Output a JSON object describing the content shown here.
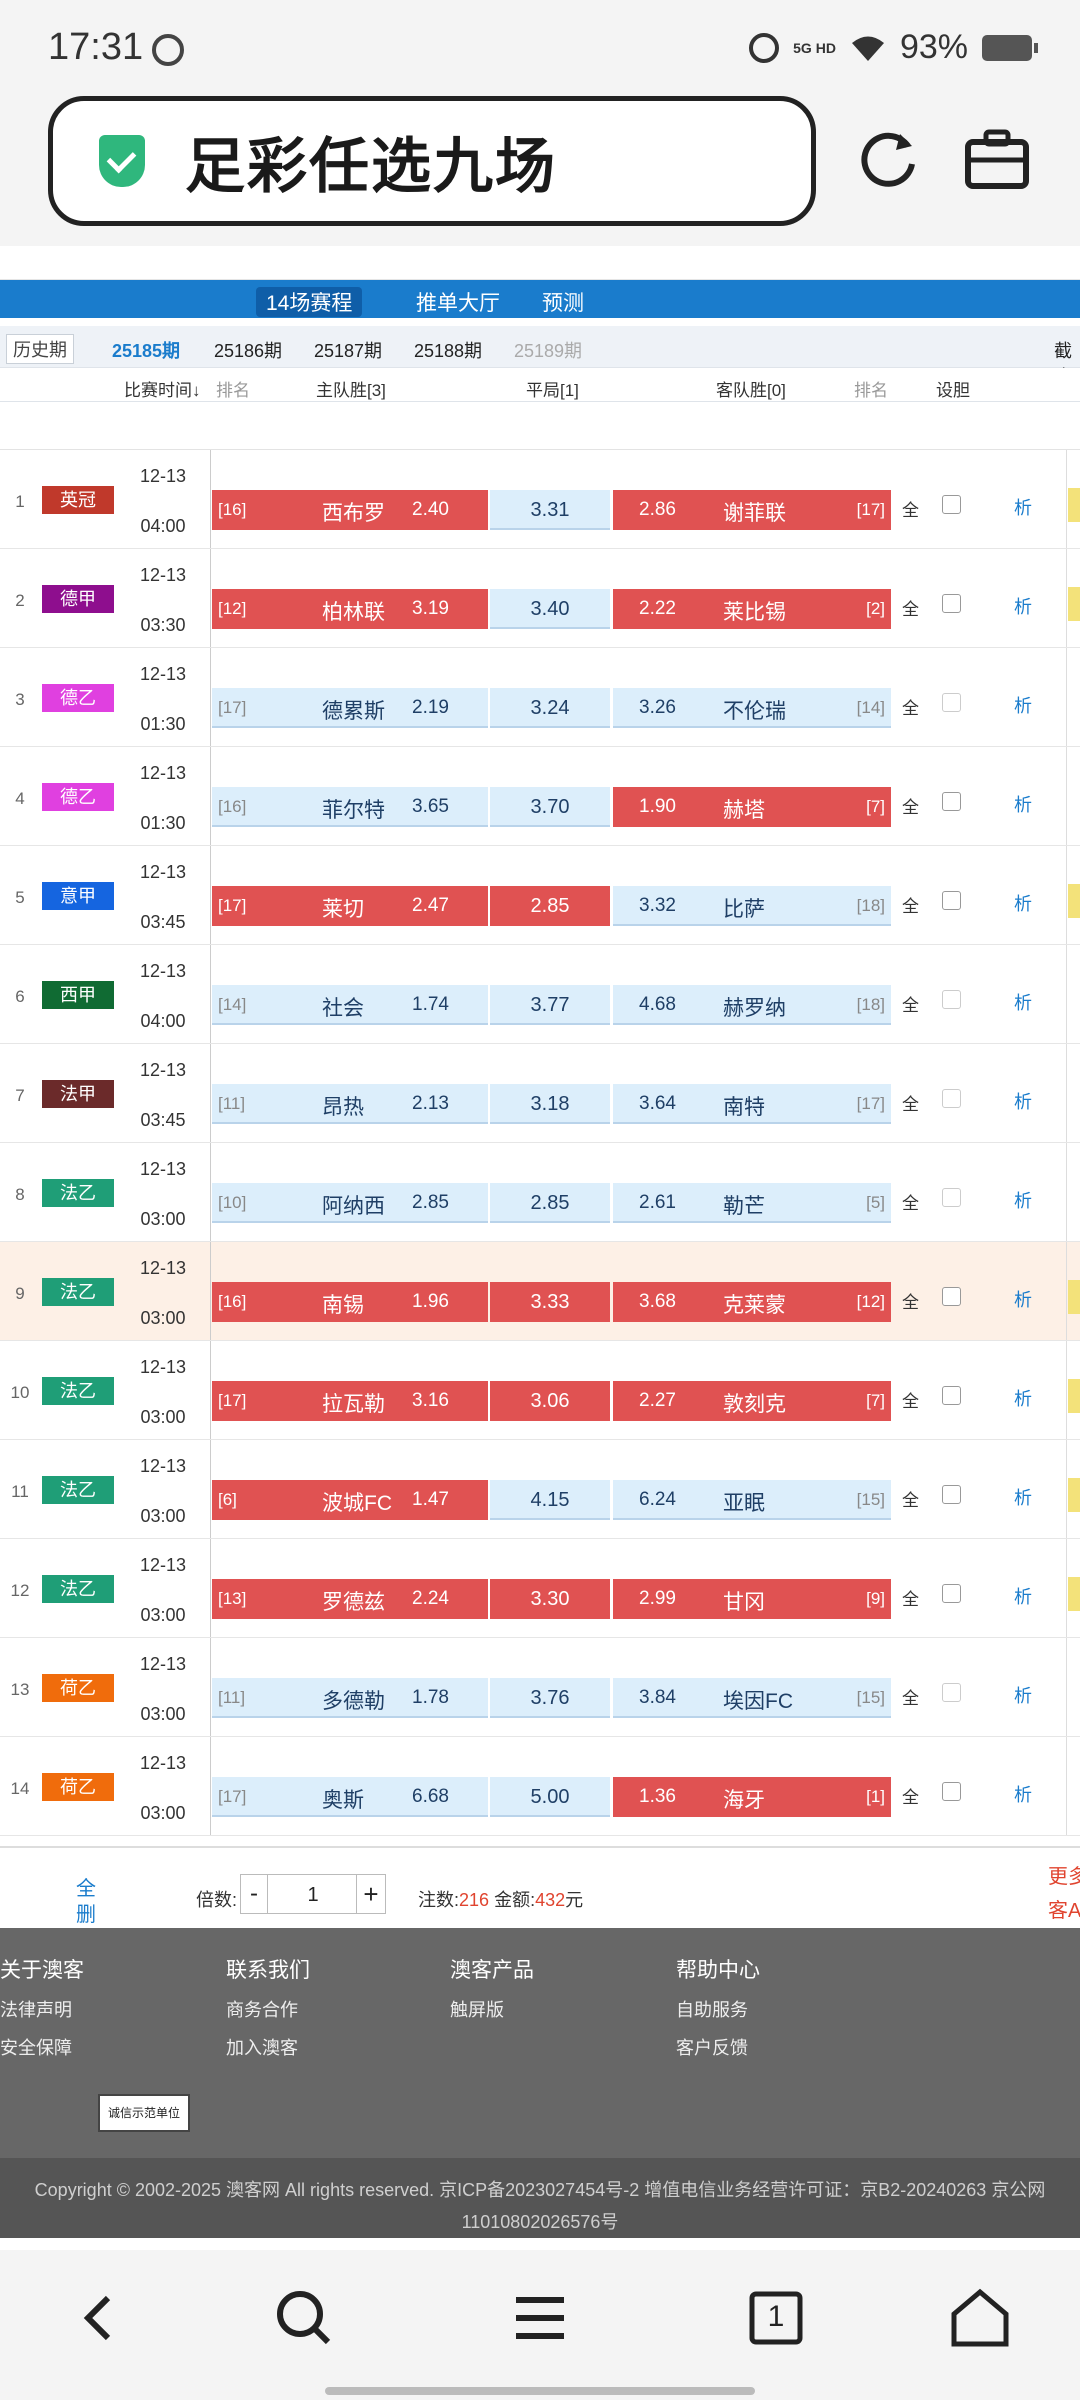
{
  "status": {
    "time": "17:31",
    "network": "5G HD",
    "battery": "93%"
  },
  "browser": {
    "title": "足彩任选九场"
  },
  "nav": {
    "tab_active": "14场赛程",
    "tab2": "推单大厅",
    "tab3": "预测"
  },
  "periods": {
    "history": "历史期",
    "current": "25185期",
    "p2": "25186期",
    "p3": "25187期",
    "p4": "25188期",
    "p5": "25189期",
    "cutoff": "截止"
  },
  "columns": {
    "time": "比赛时间↓",
    "rank_l": "排名",
    "home": "主队胜[3]",
    "draw": "平局[1]",
    "away": "客队胜[0]",
    "rank_r": "排名",
    "banker": "设胆"
  },
  "labels": {
    "all": "全",
    "analysis": "析"
  },
  "colors": {
    "hot": "#e05252",
    "cold": "#dceefb",
    "accent": "#1a7ccc"
  },
  "matches": [
    {
      "idx": "1",
      "league": "英冠",
      "league_color": "#c0392b",
      "date": "12-13",
      "time": "04:00",
      "home_rank": "[16]",
      "home": "西布罗",
      "home_odds": "2.40",
      "home_sel": true,
      "draw": "3.31",
      "draw_sel": false,
      "away_odds": "2.86",
      "away": "谢菲联",
      "away_rank": "[17]",
      "away_sel": true,
      "tab": true,
      "highlight": false
    },
    {
      "idx": "2",
      "league": "德甲",
      "league_color": "#8e0e8e",
      "date": "12-13",
      "time": "03:30",
      "home_rank": "[12]",
      "home": "柏林联",
      "home_odds": "3.19",
      "home_sel": true,
      "draw": "3.40",
      "draw_sel": false,
      "away_odds": "2.22",
      "away": "莱比锡",
      "away_rank": "[2]",
      "away_sel": true,
      "tab": true,
      "highlight": false
    },
    {
      "idx": "3",
      "league": "德乙",
      "league_color": "#e040e0",
      "date": "12-13",
      "time": "01:30",
      "home_rank": "[17]",
      "home": "德累斯",
      "home_odds": "2.19",
      "home_sel": false,
      "draw": "3.24",
      "draw_sel": false,
      "away_odds": "3.26",
      "away": "不伦瑞",
      "away_rank": "[14]",
      "away_sel": false,
      "tab": false,
      "highlight": false
    },
    {
      "idx": "4",
      "league": "德乙",
      "league_color": "#e040e0",
      "date": "12-13",
      "time": "01:30",
      "home_rank": "[16]",
      "home": "菲尔特",
      "home_odds": "3.65",
      "home_sel": false,
      "draw": "3.70",
      "draw_sel": false,
      "away_odds": "1.90",
      "away": "赫塔",
      "away_rank": "[7]",
      "away_sel": true,
      "tab": false,
      "highlight": false
    },
    {
      "idx": "5",
      "league": "意甲",
      "league_color": "#1565e0",
      "date": "12-13",
      "time": "03:45",
      "home_rank": "[17]",
      "home": "莱切",
      "home_odds": "2.47",
      "home_sel": true,
      "draw": "2.85",
      "draw_sel": true,
      "away_odds": "3.32",
      "away": "比萨",
      "away_rank": "[18]",
      "away_sel": false,
      "tab": true,
      "highlight": false
    },
    {
      "idx": "6",
      "league": "西甲",
      "league_color": "#106b33",
      "date": "12-13",
      "time": "04:00",
      "home_rank": "[14]",
      "home": "社会",
      "home_odds": "1.74",
      "home_sel": false,
      "draw": "3.77",
      "draw_sel": false,
      "away_odds": "4.68",
      "away": "赫罗纳",
      "away_rank": "[18]",
      "away_sel": false,
      "tab": false,
      "highlight": false
    },
    {
      "idx": "7",
      "league": "法甲",
      "league_color": "#6b2a2a",
      "date": "12-13",
      "time": "03:45",
      "home_rank": "[11]",
      "home": "昂热",
      "home_odds": "2.13",
      "home_sel": false,
      "draw": "3.18",
      "draw_sel": false,
      "away_odds": "3.64",
      "away": "南特",
      "away_rank": "[17]",
      "away_sel": false,
      "tab": false,
      "highlight": false
    },
    {
      "idx": "8",
      "league": "法乙",
      "league_color": "#1f9e77",
      "date": "12-13",
      "time": "03:00",
      "home_rank": "[10]",
      "home": "阿纳西",
      "home_odds": "2.85",
      "home_sel": false,
      "draw": "2.85",
      "draw_sel": false,
      "away_odds": "2.61",
      "away": "勒芒",
      "away_rank": "[5]",
      "away_sel": false,
      "tab": false,
      "highlight": false
    },
    {
      "idx": "9",
      "league": "法乙",
      "league_color": "#1f9e77",
      "date": "12-13",
      "time": "03:00",
      "home_rank": "[16]",
      "home": "南锡",
      "home_odds": "1.96",
      "home_sel": true,
      "draw": "3.33",
      "draw_sel": true,
      "away_odds": "3.68",
      "away": "克莱蒙",
      "away_rank": "[12]",
      "away_sel": true,
      "tab": true,
      "highlight": true
    },
    {
      "idx": "10",
      "league": "法乙",
      "league_color": "#1f9e77",
      "date": "12-13",
      "time": "03:00",
      "home_rank": "[17]",
      "home": "拉瓦勒",
      "home_odds": "3.16",
      "home_sel": true,
      "draw": "3.06",
      "draw_sel": true,
      "away_odds": "2.27",
      "away": "敦刻克",
      "away_rank": "[7]",
      "away_sel": true,
      "tab": true,
      "highlight": false
    },
    {
      "idx": "11",
      "league": "法乙",
      "league_color": "#1f9e77",
      "date": "12-13",
      "time": "03:00",
      "home_rank": "[6]",
      "home": "波城FC",
      "home_odds": "1.47",
      "home_sel": true,
      "draw": "4.15",
      "draw_sel": false,
      "away_odds": "6.24",
      "away": "亚眠",
      "away_rank": "[15]",
      "away_sel": false,
      "tab": true,
      "highlight": false
    },
    {
      "idx": "12",
      "league": "法乙",
      "league_color": "#1f9e77",
      "date": "12-13",
      "time": "03:00",
      "home_rank": "[13]",
      "home": "罗德兹",
      "home_odds": "2.24",
      "home_sel": true,
      "draw": "3.30",
      "draw_sel": true,
      "away_odds": "2.99",
      "away": "甘冈",
      "away_rank": "[9]",
      "away_sel": true,
      "tab": true,
      "highlight": false
    },
    {
      "idx": "13",
      "league": "荷乙",
      "league_color": "#f06c0c",
      "date": "12-13",
      "time": "03:00",
      "home_rank": "[11]",
      "home": "多德勒",
      "home_odds": "1.78",
      "home_sel": false,
      "draw": "3.76",
      "draw_sel": false,
      "away_odds": "3.84",
      "away": "埃因FC",
      "away_rank": "[15]",
      "away_sel": false,
      "tab": false,
      "highlight": false
    },
    {
      "idx": "14",
      "league": "荷乙",
      "league_color": "#f06c0c",
      "date": "12-13",
      "time": "03:00",
      "home_rank": "[17]",
      "home": "奥斯",
      "home_odds": "6.68",
      "home_sel": false,
      "draw": "5.00",
      "draw_sel": false,
      "away_odds": "1.36",
      "away": "海牙",
      "away_rank": "[1]",
      "away_sel": true,
      "tab": false,
      "highlight": false
    }
  ],
  "bottom": {
    "clear": "全删",
    "multiplier_label": "倍数:",
    "minus": "-",
    "multiplier": "1",
    "plus": "+",
    "notes_label": "注数:",
    "notes": "216",
    "amount_label": "金额:",
    "amount": "432",
    "unit": "元",
    "more": "更多客A流Q"
  },
  "footer": {
    "about": "关于澳客",
    "about_links": [
      "法律声明",
      "安全保障"
    ],
    "contact": "联系我们",
    "contact_links": [
      "商务合作",
      "加入澳客"
    ],
    "products": "澳客产品",
    "products_links": [
      "触屏版"
    ],
    "help": "帮助中心",
    "help_links": [
      "自助服务",
      "客户反馈"
    ],
    "badge": "诚信示范单位"
  },
  "copyright": {
    "line1": "Copyright © 2002-2025 澳客网  All rights reserved.    京ICP备2023027454号-2  增值电信业务经营许可证：京B2-20240263  京公网",
    "line2": "11010802026576号"
  },
  "bottom_nav": {
    "tabs_count": "1"
  }
}
